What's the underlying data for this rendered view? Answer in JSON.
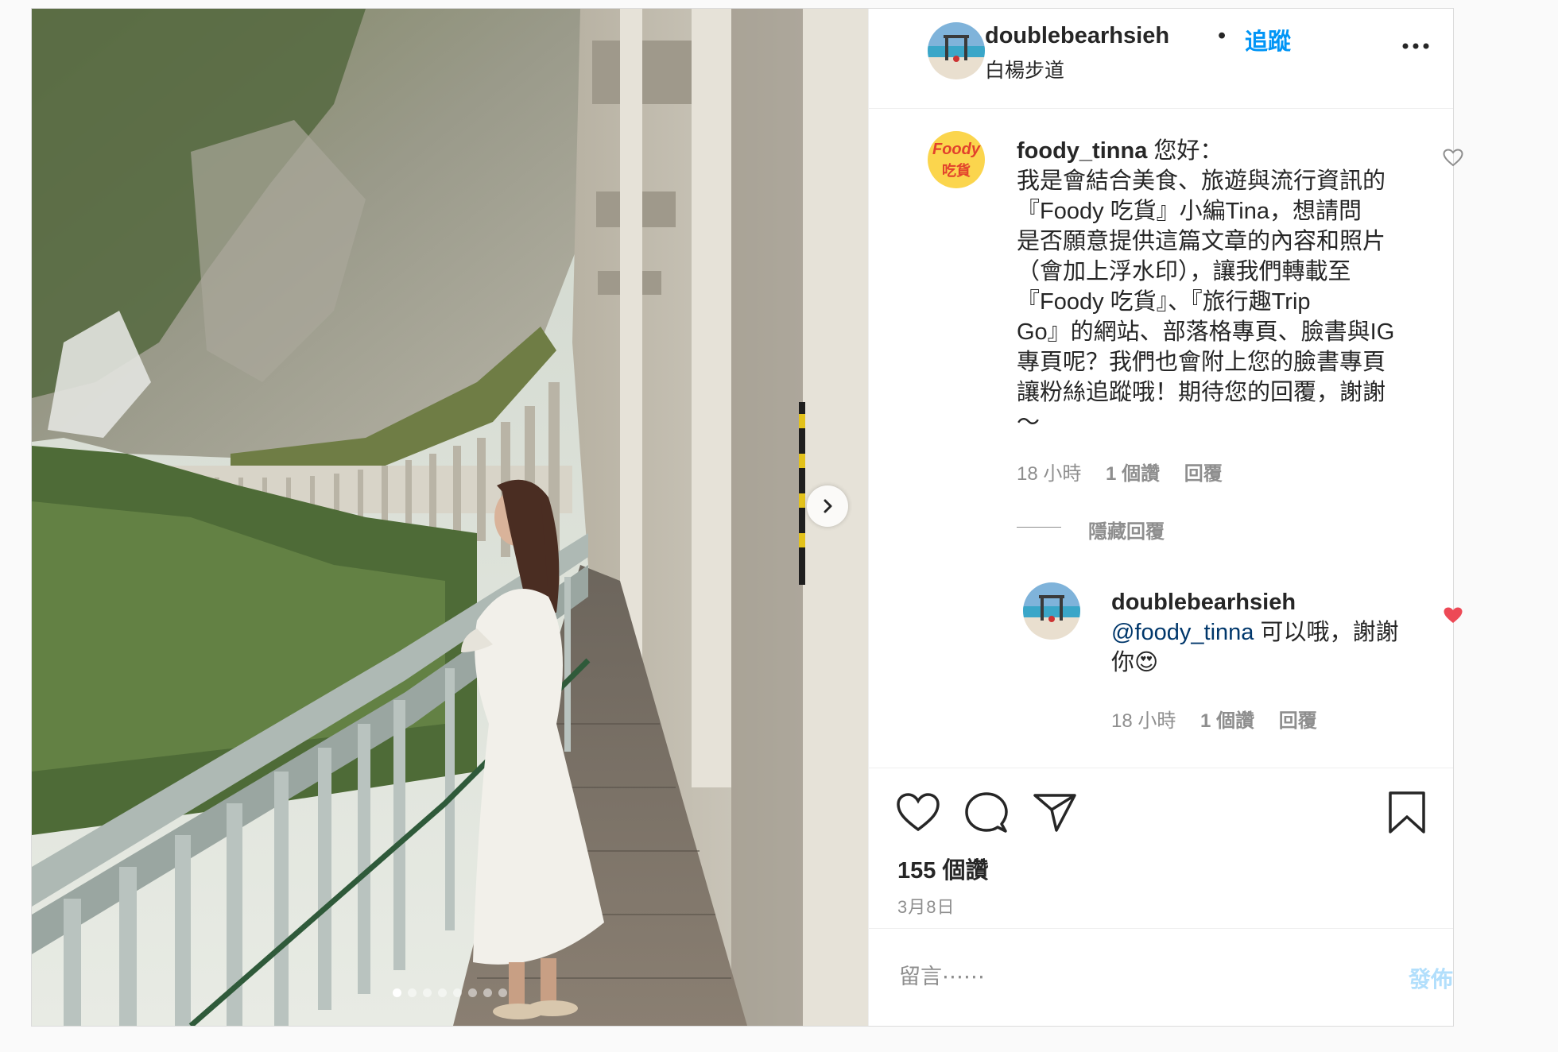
{
  "header": {
    "username": "doublebearhsieh",
    "separator": "•",
    "follow_label": "追蹤",
    "location": "白楊步道",
    "more_icon": "more-horizontal-icon"
  },
  "comments": {
    "main": {
      "username": "foody_tinna",
      "avatar_text_top": "Foody",
      "avatar_text_bottom": "吃貨",
      "lines": [
        " 您好：",
        "我是會結合美食、旅遊與流行資訊的",
        "『Foody 吃貨』小編Tina，想請問",
        "是否願意提供這篇文章的內容和照片",
        "（會加上浮水印），讓我們轉載至",
        "『Foody 吃貨』、『旅行趣Trip",
        "Go』的網站、部落格專頁、臉書與IG",
        "專頁呢？我們也會附上您的臉書專頁",
        "讓粉絲追蹤哦！期待您的回覆，謝謝",
        "～"
      ],
      "time": "18 小時",
      "likes": "1 個讚",
      "reply": "回覆",
      "heart_icon": "heart-outline-icon"
    },
    "hide_replies": "隱藏回覆",
    "reply": {
      "username": "doublebearhsieh",
      "mention": "@foody_tinna",
      "text_after_mention": " 可以哦，謝謝",
      "text_line2": "你",
      "emoji": "😍",
      "time": "18 小時",
      "likes": "1 個讚",
      "reply": "回覆",
      "heart_icon": "heart-filled-icon",
      "heart_color": "#ed4956"
    }
  },
  "actions": {
    "like_icon": "heart-icon",
    "comment_icon": "comment-icon",
    "share_icon": "paper-plane-icon",
    "save_icon": "bookmark-icon",
    "likes_count": "155 個讚",
    "date": "3月8日"
  },
  "add_comment": {
    "placeholder": "留言⋯⋯",
    "post_label": "發佈"
  },
  "carousel": {
    "next_icon": "chevron-right-icon",
    "slides": 8,
    "active_slide": 1
  },
  "colors": {
    "link_blue": "#0095f6",
    "mention_blue": "#00376b",
    "muted": "#8e8e8e",
    "like_red": "#ed4956"
  }
}
